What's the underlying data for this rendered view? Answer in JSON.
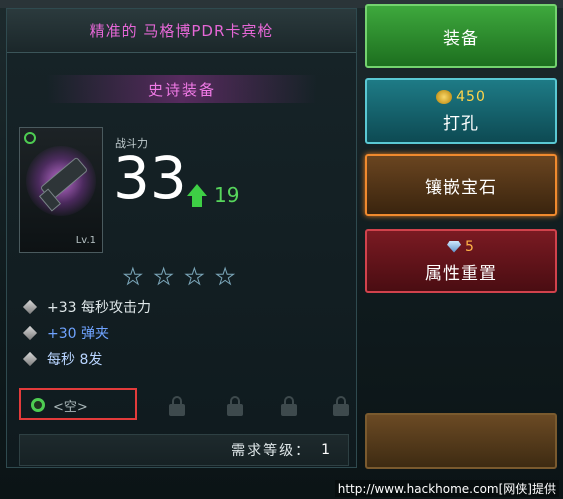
{
  "item": {
    "name": "精准的 马格博PDR卡宾枪",
    "quality": "史诗装备",
    "level": "Lv.1",
    "power_label": "战斗力",
    "power": "33",
    "power_delta": "19",
    "stars": 4,
    "attributes": [
      {
        "text": "+33 每秒攻击力",
        "color": "#dfe7e9"
      },
      {
        "text": "+30 弹夹",
        "color": "#6fa3ff"
      },
      {
        "text": "每秒 8发",
        "color": "#b8d4ff"
      }
    ],
    "socket": {
      "text": "<空>"
    },
    "requirement": {
      "label": "需求等级：",
      "value": "1"
    }
  },
  "actions": {
    "equip": "装备",
    "punch": {
      "label": "打孔",
      "cost": "450"
    },
    "inlay": "镶嵌宝石",
    "reset": {
      "label": "属性重置",
      "cost": "5"
    }
  },
  "watermark": "http://www.hackhome.com[网侠]提供",
  "colors": {
    "accent_purple": "#e567d6",
    "socket_highlight": "#e33b3b",
    "green": "#3ecf45"
  }
}
